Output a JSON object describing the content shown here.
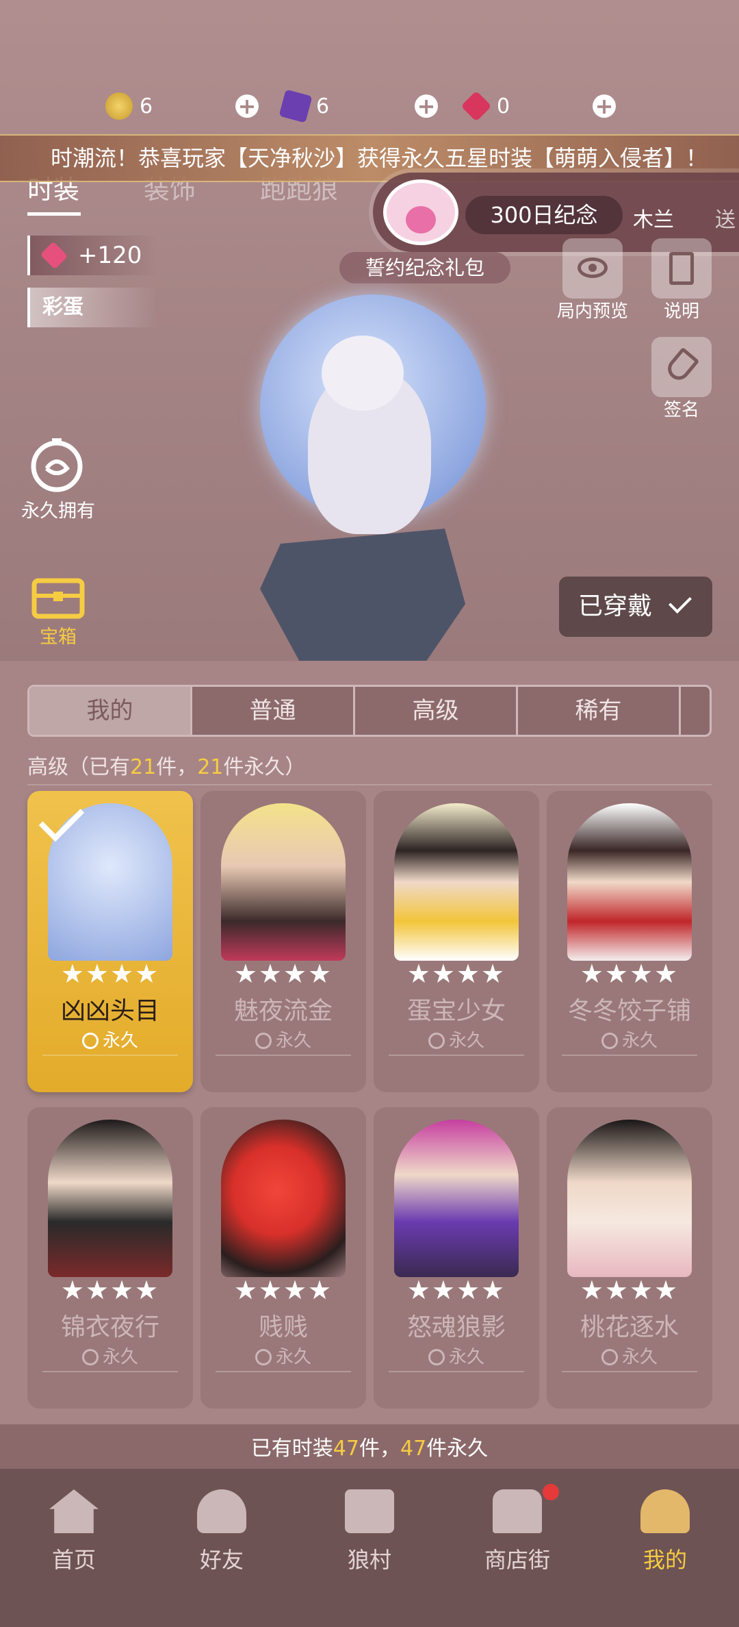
{
  "currency": {
    "gold": "6",
    "purple": "6",
    "gem": "0",
    "plus": "+"
  },
  "marquee": "时潮流！恭喜玩家【天净秋沙】获得永久五星时装【萌萌入侵者】！",
  "top_tabs": [
    "时装",
    "装饰",
    "跑跑狼"
  ],
  "anniversary": {
    "label": "300日纪念",
    "name": "木兰",
    "send": "送",
    "gift": "誓约纪念礼包"
  },
  "left_chips": {
    "gem_value": "+120",
    "egg_label": "彩蛋"
  },
  "right_buttons": {
    "preview": "局内预览",
    "help": "说明",
    "sign": "签名"
  },
  "side_icons": {
    "permanent": "永久拥有",
    "chest": "宝箱"
  },
  "worn_button": "已穿戴",
  "category_tabs": [
    "我的",
    "普通",
    "高级",
    "稀有"
  ],
  "count_line": {
    "prefix": "高级（已有",
    "owned": "21",
    "mid": "件，",
    "perm": "21",
    "suffix": "件永久）"
  },
  "cards": [
    {
      "name": "凶凶头目",
      "stars": "★★★★",
      "perm": "永久"
    },
    {
      "name": "魅夜流金",
      "stars": "★★★★",
      "perm": "永久"
    },
    {
      "name": "蛋宝少女",
      "stars": "★★★★",
      "perm": "永久"
    },
    {
      "name": "冬冬饺子铺",
      "stars": "★★★★",
      "perm": "永久"
    },
    {
      "name": "锦衣夜行",
      "stars": "★★★★",
      "perm": "永久"
    },
    {
      "name": "贱贱",
      "stars": "★★★★",
      "perm": "永久"
    },
    {
      "name": "怒魂狼影",
      "stars": "★★★★",
      "perm": "永久"
    },
    {
      "name": "桃花逐水",
      "stars": "★★★★",
      "perm": "永久"
    }
  ],
  "total_line": {
    "prefix": "已有时装",
    "owned": "47",
    "mid": "件，",
    "perm": "47",
    "suffix": "件永久"
  },
  "bottom_nav": [
    "首页",
    "好友",
    "狼村",
    "商店街",
    "我的"
  ],
  "colors": {
    "accent_gold": "#f6cc43",
    "selected_card": "#e3ab2a",
    "background": "#a98788",
    "nav_bg": "#6e5354",
    "badge": "#e53a3a"
  }
}
